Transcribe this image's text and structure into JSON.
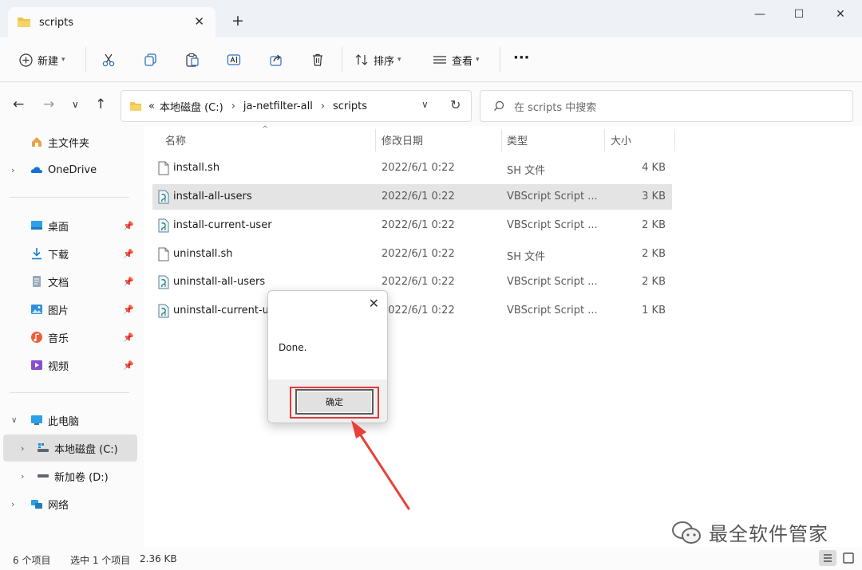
{
  "window": {
    "tab_title": "scripts",
    "tab_close": "✕",
    "new_tab": "+",
    "minimize": "—",
    "maximize": "☐",
    "close": "✕"
  },
  "toolbar": {
    "new_label": "新建",
    "sort_label": "排序",
    "view_label": "查看",
    "more": "···"
  },
  "address": {
    "overflow": "«",
    "crumbs": [
      "本地磁盘 (C:)",
      "ja-netfilter-all",
      "scripts"
    ],
    "search_placeholder": "在 scripts 中搜索"
  },
  "sidebar": {
    "home": "主文件夹",
    "onedrive": "OneDrive",
    "quick": [
      {
        "label": "桌面",
        "icon": "desktop-icon",
        "color": "#2aa0e8"
      },
      {
        "label": "下载",
        "icon": "download-icon",
        "color": "#1a7fd4"
      },
      {
        "label": "文档",
        "icon": "document-icon",
        "color": "#7c8ea3"
      },
      {
        "label": "图片",
        "icon": "pictures-icon",
        "color": "#2f8fd9"
      },
      {
        "label": "音乐",
        "icon": "music-icon",
        "color": "#e9603a"
      },
      {
        "label": "视频",
        "icon": "video-icon",
        "color": "#8a4fcf"
      }
    ],
    "this_pc": "此电脑",
    "drive_c": "本地磁盘 (C:)",
    "drive_d": "新加卷 (D:)",
    "network": "网络"
  },
  "columns": {
    "name": "名称",
    "date": "修改日期",
    "type": "类型",
    "size": "大小"
  },
  "files": [
    {
      "name": "install.sh",
      "date": "2022/6/1 0:22",
      "type": "SH 文件",
      "size": "4 KB",
      "kind": "text"
    },
    {
      "name": "install-all-users",
      "date": "2022/6/1 0:22",
      "type": "VBScript Script ...",
      "size": "3 KB",
      "kind": "vbs",
      "selected": true
    },
    {
      "name": "install-current-user",
      "date": "2022/6/1 0:22",
      "type": "VBScript Script ...",
      "size": "2 KB",
      "kind": "vbs"
    },
    {
      "name": "uninstall.sh",
      "date": "2022/6/1 0:22",
      "type": "SH 文件",
      "size": "2 KB",
      "kind": "text"
    },
    {
      "name": "uninstall-all-users",
      "date": "2022/6/1 0:22",
      "type": "VBScript Script ...",
      "size": "2 KB",
      "kind": "vbs"
    },
    {
      "name": "uninstall-current-user",
      "date": "2022/6/1 0:22",
      "type": "VBScript Script ...",
      "size": "1 KB",
      "kind": "vbs"
    }
  ],
  "status": {
    "count": "6 个项目",
    "selected": "选中 1 个项目",
    "size": "2.36 KB"
  },
  "dialog": {
    "close": "✕",
    "message": "Done.",
    "ok_label": "确定"
  },
  "watermark": {
    "text": "最全软件管家"
  },
  "colors": {
    "highlight": "#e03a3a",
    "folder": "#f0c34a",
    "selection": "#e4e4e4"
  }
}
